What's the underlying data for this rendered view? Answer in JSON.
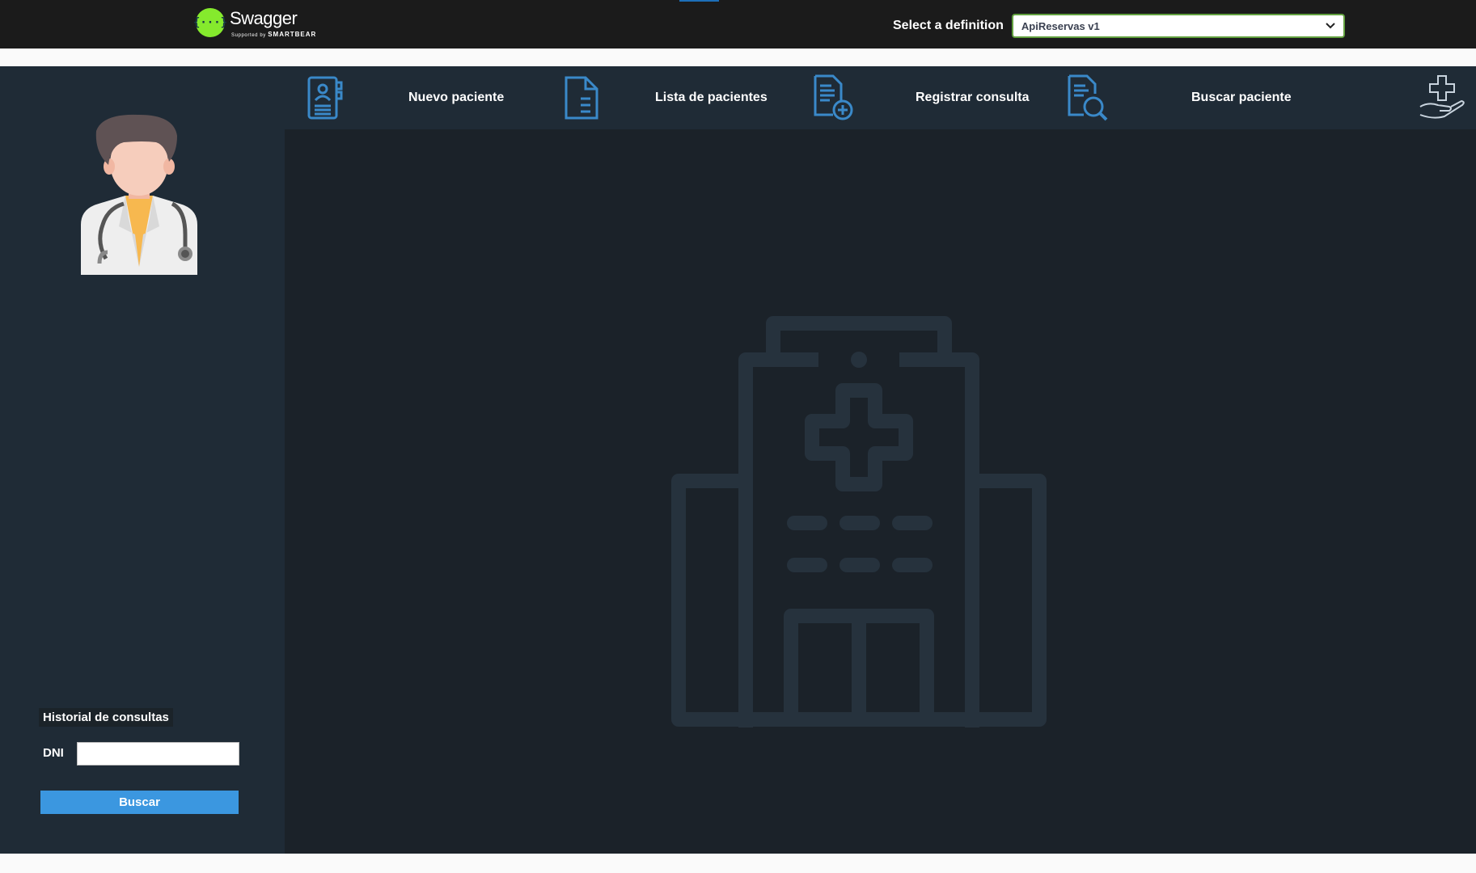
{
  "swagger": {
    "logo_name": "Swagger",
    "logo_sub_prefix": "Supported by",
    "logo_sub_brand": "SMARTBEAR",
    "logo_mark": "{···}",
    "definition_label": "Select a definition",
    "definition_value": "ApiReservas v1",
    "definition_options": [
      "ApiReservas v1"
    ]
  },
  "nav": {
    "items": [
      {
        "label": "Nuevo paciente",
        "icon": "patient-record-icon"
      },
      {
        "label": "Lista de pacientes",
        "icon": "document-list-icon"
      },
      {
        "label": "Registrar consulta",
        "icon": "document-add-icon"
      },
      {
        "label": "Buscar paciente",
        "icon": "document-search-icon"
      }
    ],
    "brand_icon": "hand-medical-cross-icon"
  },
  "sidebar": {
    "avatar_icon": "doctor-avatar-icon",
    "history_title": "Historial de consultas",
    "dni_label": "DNI",
    "dni_value": "",
    "search_label": "Buscar"
  },
  "main": {
    "background_icon": "hospital-building-icon"
  },
  "colors": {
    "topbar_bg": "#1b1b1b",
    "swagger_green": "#85ea2d",
    "app_bg": "#1b2229",
    "sidebar_bg": "#1f2b36",
    "accent_blue": "#3b97e0",
    "icon_blue": "#3a89c9",
    "watermark": "#26323d"
  }
}
